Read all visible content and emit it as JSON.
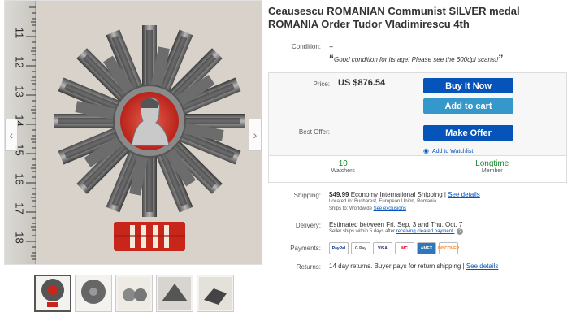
{
  "title": "Ceausescu ROMANIAN Communist SILVER medal ROMANIA Order Tudor Vladimirescu 4th",
  "ruler": {
    "ticks": [
      "11",
      "12",
      "13",
      "14",
      "15",
      "16",
      "17",
      "18"
    ]
  },
  "gallery": {
    "prev_icon": "chevron-left-icon",
    "next_icon": "chevron-right-icon",
    "prev_glyph": "‹",
    "next_glyph": "›"
  },
  "condition": {
    "label": "Condition:",
    "value": "--",
    "quote": "Good condition for its age! Please see the 600dpi scans!!"
  },
  "price": {
    "label": "Price:",
    "value": "US $876.54"
  },
  "buttons": {
    "buy_now": "Buy It Now",
    "add_to_cart": "Add to cart",
    "make_offer": "Make Offer"
  },
  "best_offer": {
    "label": "Best Offer:"
  },
  "watchlist": {
    "label": "Add to Watchlist",
    "icon": "eye-icon"
  },
  "stats": [
    {
      "number": "10",
      "label": "Watchers"
    },
    {
      "number": "Longtime",
      "label": "Member"
    }
  ],
  "shipping": {
    "label": "Shipping:",
    "cost": "$49.99",
    "method": "Economy International Shipping |",
    "details_link": "See details",
    "located": "Located in: Bucharest, European Union, Romania",
    "ships_to": "Ships to: Worldwide",
    "exclusions_link": "See exclusions"
  },
  "delivery": {
    "label": "Delivery:",
    "estimate": "Estimated between Fri. Sep. 3 and Thu. Oct. 7",
    "note": "Seller ships within 5 days after",
    "note_link": "receiving cleared payment."
  },
  "payments": {
    "label": "Payments:",
    "methods": [
      "PayPal",
      "G Pay",
      "VISA",
      "MC",
      "AMEX",
      "DISCOVER"
    ]
  },
  "returns": {
    "label": "Returns:",
    "text": "14 day returns. Buyer pays for return shipping |",
    "details_link": "See details"
  }
}
